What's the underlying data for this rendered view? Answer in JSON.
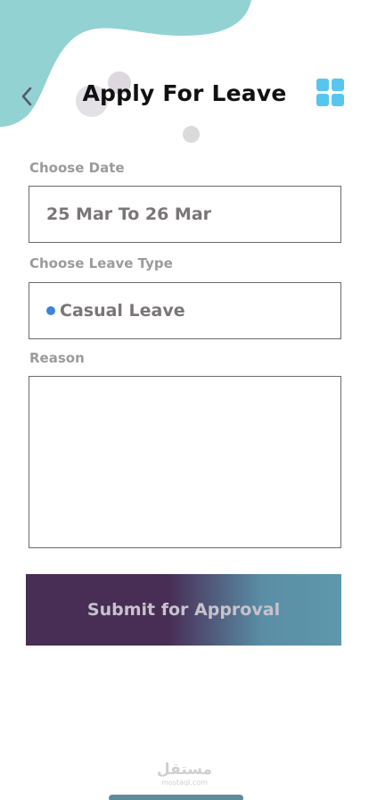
{
  "header": {
    "title": "Apply For Leave",
    "back_icon": "chevron-left-icon",
    "menu_icon": "grid-icon",
    "accent_color": "#57c6ef",
    "blob_color": "#93d2d3"
  },
  "form": {
    "date": {
      "label": "Choose Date",
      "value": "25 Mar To 26 Mar"
    },
    "leave_type": {
      "label": "Choose Leave Type",
      "value": "Casual Leave",
      "dot_color": "#3a84dc"
    },
    "reason": {
      "label": "Reason",
      "value": ""
    }
  },
  "submit": {
    "label": "Submit for Approval"
  },
  "watermark": {
    "text": "مستقل",
    "sub": "mostaql.com"
  }
}
